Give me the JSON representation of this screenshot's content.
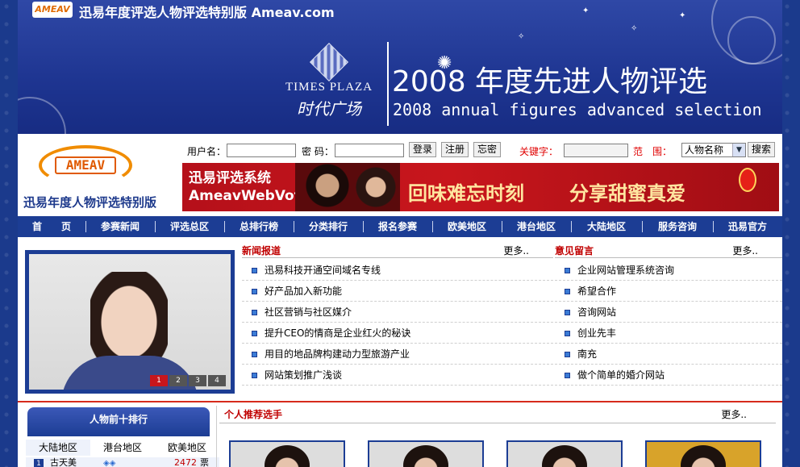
{
  "banner": {
    "logo_text": "AMEAV",
    "top_title": "迅易年度评选人物评选特别版 Ameav.com",
    "plaza_name": "TIMES PLAZA",
    "plaza_cn": "时代广场",
    "headline_cn": "2008 年度先进人物评选",
    "headline_en": "2008 annual figures advanced selection"
  },
  "brand": {
    "logo_text": "AMEAV",
    "site_title": "迅易年度人物评选特别版"
  },
  "login": {
    "username_label": "用户名：",
    "password_label": "密 码：",
    "login_button": "登录",
    "register_button": "注册",
    "forgot_button": "忘密",
    "keyword_label": "关键字：",
    "scope_label": "范　围：",
    "scope_value": "人物名称",
    "search_button": "搜索"
  },
  "ad": {
    "left_line1": "迅易评选系统",
    "left_line2": "AmeavWebVote",
    "slogan1": "回味难忘时刻",
    "slogan2": "分享甜蜜真爱"
  },
  "nav": [
    "首　　页",
    "参赛新闻",
    "评选总区",
    "总排行榜",
    "分类排行",
    "报名参赛",
    "欧美地区",
    "港台地区",
    "大陆地区",
    "服务咨询",
    "迅易官方"
  ],
  "photo_tabs": [
    "1",
    "2",
    "3",
    "4"
  ],
  "news": {
    "title": "新闻报道",
    "more": "更多..",
    "items": [
      "迅易科技开通空间域名专线",
      "好产品加入新功能",
      "社区营销与社区媒介",
      "提升CEO的情商是企业红火的秘诀",
      "用目的地品牌构建动力型旅游产业",
      "网站策划推广浅谈"
    ]
  },
  "feedback": {
    "title": "意见留言",
    "more": "更多..",
    "items": [
      "企业网站管理系统咨询",
      "希望合作",
      "咨询网站",
      "创业先丰",
      "南充",
      "做个简单的婚介网站"
    ]
  },
  "ranking": {
    "title": "人物前十排行",
    "tabs": [
      "大陆地区",
      "港台地区",
      "欧美地区"
    ],
    "rows": [
      {
        "num": "1",
        "name": "古天美",
        "score": "2472",
        "unit": "票"
      }
    ]
  },
  "recommend": {
    "title": "个人推荐选手",
    "more": "更多.."
  }
}
